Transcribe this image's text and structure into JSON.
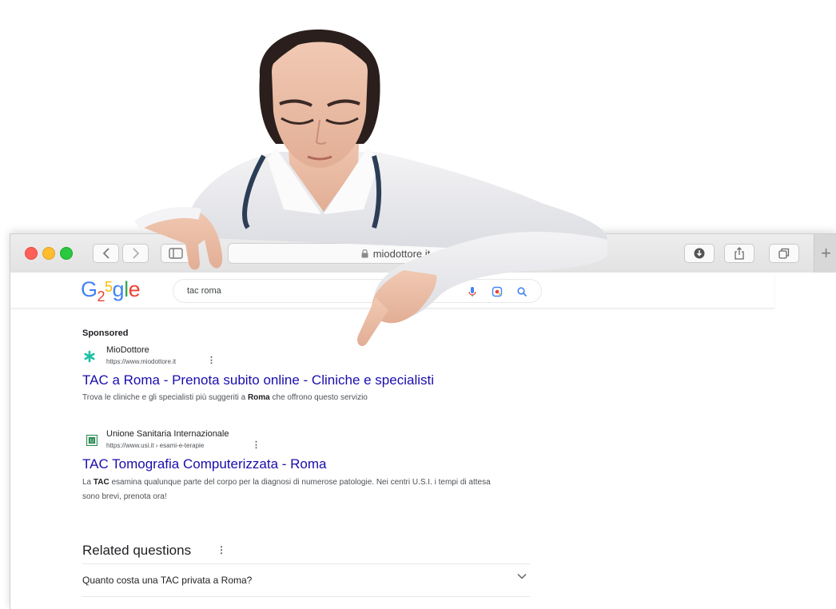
{
  "browser": {
    "url": "miodottore.it",
    "new_tab_label": "+"
  },
  "google": {
    "logo_letters": [
      "G",
      "2",
      "5",
      "g",
      "l",
      "e"
    ],
    "search_query": "tac roma"
  },
  "results": {
    "sponsored_label": "Sponsored",
    "ads": [
      {
        "site_name": "MioDottore",
        "site_url": "https://www.miodottore.it",
        "title": "TAC a Roma - Prenota subito online - Cliniche e specialisti",
        "description_parts": [
          "Trova le cliniche e gli specialisti più suggeriti a ",
          "Roma",
          " che offrono questo servizio"
        ]
      },
      {
        "site_name": "Unione Sanitaria Internazionale",
        "site_url": "https://www.usi.it › esami-e-terapie",
        "title": "TAC Tomografia Computerizzata - Roma",
        "description_parts": [
          "La ",
          "TAC",
          " esamina qualunque parte del corpo per la diagnosi di numerose patologie. Nei centri U.S.I. i tempi di attesa sono brevi, prenota ora!"
        ]
      }
    ]
  },
  "related_questions": {
    "title": "Related questions",
    "items": [
      "Quanto costa una TAC privata a Roma?"
    ]
  },
  "colors": {
    "link": "#1a0dab",
    "logo": [
      "#4285f4",
      "#ea4335",
      "#fbbc05",
      "#4285f4",
      "#34a853",
      "#ea4335"
    ]
  },
  "icons": [
    "back-icon",
    "forward-icon",
    "sidebar-icon",
    "lock-icon",
    "download-icon",
    "share-icon",
    "tabs-icon",
    "mic-icon",
    "lens-icon",
    "search-icon",
    "chevron-down-icon",
    "kebab-icon"
  ]
}
